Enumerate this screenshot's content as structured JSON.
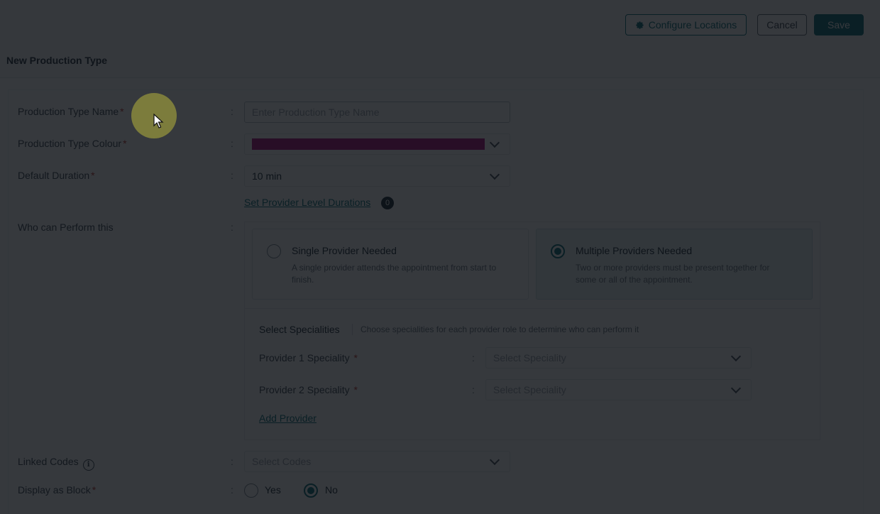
{
  "toolbar": {
    "configure_label": "Configure Locations",
    "cancel_label": "Cancel",
    "save_label": "Save"
  },
  "page_title": "New Production Type",
  "form": {
    "name": {
      "label": "Production Type Name",
      "placeholder": "Enter Production Type Name",
      "value": ""
    },
    "colour": {
      "label": "Production Type Colour",
      "value": "#b0127e"
    },
    "duration": {
      "label": "Default Duration",
      "value": "10 min"
    },
    "provider_durations_link": "Set Provider Level Durations",
    "provider_durations_count": "0",
    "performer": {
      "label": "Who can Perform this",
      "options": [
        {
          "title": "Single Provider Needed",
          "desc": "A single provider attends the appointment from start to finish.",
          "selected": false
        },
        {
          "title": "Multiple Providers Needed",
          "desc": "Two or more providers must be present together for some or all of the appointment.",
          "selected": true
        }
      ],
      "specialities_title": "Select Specialities",
      "specialities_hint": "Choose specialities for each provider role to determine who can perform it",
      "providers": [
        {
          "label": "Provider 1 Speciality",
          "placeholder": "Select Speciality"
        },
        {
          "label": "Provider 2 Speciality",
          "placeholder": "Select Speciality"
        }
      ],
      "add_provider": "Add Provider"
    },
    "linked_codes": {
      "label": "Linked Codes",
      "placeholder": "Select Codes"
    },
    "display_block": {
      "label": "Display as Block",
      "options": [
        "Yes",
        "No"
      ],
      "selected": "No"
    }
  },
  "colors": {
    "accent": "#0d6d78",
    "required": "#b8332c",
    "swatch": "#b0127e"
  },
  "required_mark": "*",
  "colon": ":",
  "icons": [
    "gear-icon",
    "chevron-down-icon",
    "info-icon",
    "cursor-icon"
  ]
}
